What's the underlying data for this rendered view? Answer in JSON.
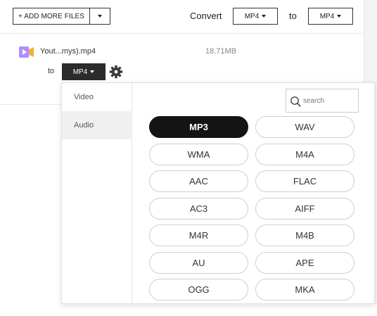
{
  "toolbar": {
    "add_files_label": "+ ADD MORE FILES",
    "convert_label": "Convert",
    "from_format": "MP4",
    "to_label": "to",
    "to_format": "MP4"
  },
  "file": {
    "name": "Yout...mys).mp4",
    "size": "18.71MB",
    "to_label": "to",
    "target_format": "MP4"
  },
  "popup": {
    "categories": [
      {
        "label": "Video",
        "selected": false
      },
      {
        "label": "Audio",
        "selected": true
      }
    ],
    "search": {
      "placeholder": "search",
      "value": ""
    },
    "selected_format": "MP3",
    "formats": [
      "MP3",
      "WAV",
      "WMA",
      "M4A",
      "AAC",
      "FLAC",
      "AC3",
      "AIFF",
      "M4R",
      "M4B",
      "AU",
      "APE",
      "OGG",
      "MKA"
    ]
  },
  "colors": {
    "selected_bg": "#141414",
    "accent_icon": "#b18cff",
    "dark_button": "#2b2b2b"
  }
}
